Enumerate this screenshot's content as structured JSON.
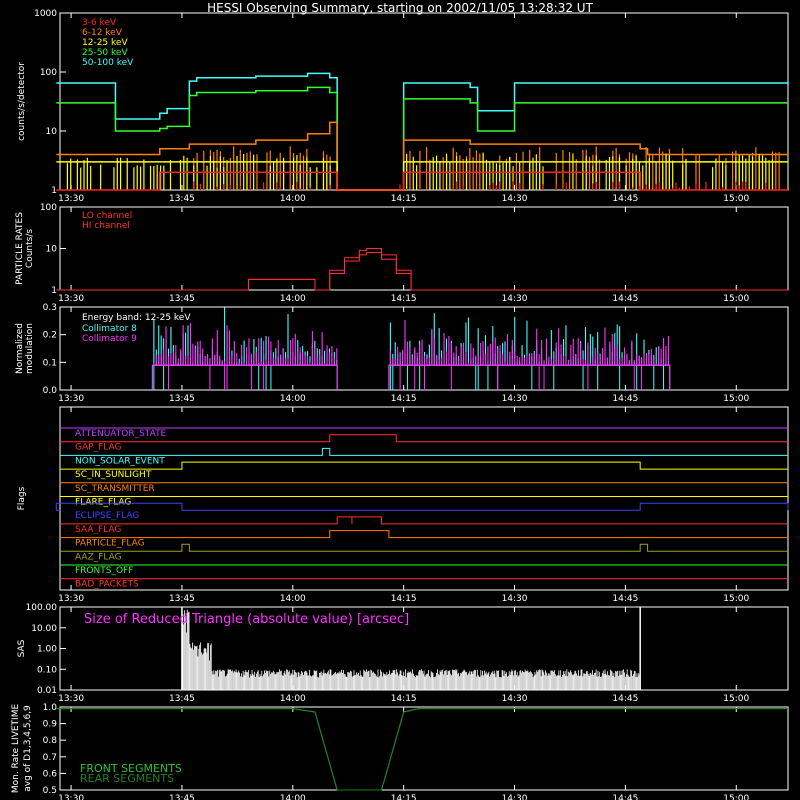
{
  "title": "HESSI Observing Summary, starting on 2002/11/05 13:28:32 UT",
  "time_ticks": [
    "13:30",
    "13:45",
    "14:00",
    "14:15",
    "14:30",
    "14:45",
    "15:00"
  ],
  "colors": {
    "axis": "#ffffff",
    "e3_6": "#ff2020",
    "e6_12": "#ff8000",
    "e12_25": "#ffff00",
    "e25_50": "#30ff30",
    "e50_100": "#40ffff",
    "lo": "#ff3030",
    "hi": "#ff3030",
    "coll8": "#40ffff",
    "coll9": "#ff30ff",
    "sas": "#ff30ff",
    "front": "#30c030",
    "rear": "#208020"
  },
  "chart_data": [
    {
      "type": "line",
      "panel": "count_rates",
      "ylabel": "counts/s/detector",
      "yscale": "log",
      "ylim": [
        1,
        1000
      ],
      "yticks": [
        "1",
        "10",
        "100",
        "1000"
      ],
      "x": [
        "13:28",
        "13:35",
        "13:36",
        "13:42",
        "13:43",
        "13:46",
        "13:47",
        "13:55",
        "14:02",
        "14:05",
        "14:06",
        "14:14",
        "14:15",
        "14:24",
        "14:25",
        "14:30",
        "14:40",
        "14:47",
        "14:48",
        "15:00",
        "15:07"
      ],
      "series": [
        {
          "name": "3-6 keV",
          "values": [
            1,
            1,
            1,
            2,
            2,
            2,
            2,
            2,
            2,
            2,
            1,
            1,
            2,
            2,
            2,
            2,
            2,
            1,
            1,
            1,
            1
          ]
        },
        {
          "name": "6-12 keV",
          "values": [
            4,
            4,
            4,
            5,
            5,
            6,
            6,
            7,
            9,
            14,
            1,
            1,
            7,
            6,
            6,
            6,
            6,
            5,
            4,
            4,
            4
          ]
        },
        {
          "name": "12-25 keV",
          "values": [
            3,
            3,
            3,
            3,
            3,
            3,
            3,
            3,
            3,
            3,
            1,
            1,
            3,
            3,
            3,
            3,
            3,
            3,
            3,
            3,
            3
          ]
        },
        {
          "name": "25-50 keV",
          "values": [
            30,
            30,
            10,
            11,
            12,
            40,
            45,
            48,
            55,
            45,
            1,
            1,
            35,
            30,
            10,
            30,
            30,
            30,
            30,
            30,
            30
          ]
        },
        {
          "name": "50-100 keV",
          "values": [
            65,
            65,
            16,
            20,
            24,
            70,
            80,
            85,
            95,
            80,
            1,
            1,
            65,
            55,
            22,
            65,
            65,
            65,
            65,
            65,
            60
          ]
        }
      ]
    },
    {
      "type": "line",
      "panel": "particle_rates",
      "ylabel": "PARTICLE RATES Counts/s",
      "yscale": "log",
      "ylim": [
        1,
        100
      ],
      "yticks": [
        "1",
        "10",
        "100"
      ],
      "x": [
        "13:28",
        "13:52",
        "13:54",
        "14:03",
        "14:05",
        "14:07",
        "14:09",
        "14:10",
        "14:12",
        "14:14",
        "14:16",
        "15:07"
      ],
      "series": [
        {
          "name": "LO channel",
          "values": [
            1,
            1,
            1.8,
            1,
            3,
            6,
            9,
            10,
            7,
            3,
            1,
            1
          ]
        },
        {
          "name": "HI channel",
          "values": [
            1,
            1,
            1.8,
            1,
            2.5,
            5,
            7,
            8,
            5.5,
            2.5,
            1,
            1
          ]
        }
      ]
    },
    {
      "type": "line",
      "panel": "modulation",
      "ylabel": "Normalized modulation",
      "ylim": [
        0,
        0.3
      ],
      "yticks": [
        "0.0",
        "0.1",
        "0.2",
        "0.3"
      ],
      "annotation": "Energy band: 12-25 keV",
      "x_range": [
        [
          "13:41",
          "14:06"
        ],
        [
          "14:13",
          "14:51"
        ]
      ],
      "series": [
        {
          "name": "Collimator 8",
          "baseline": 0.09,
          "max": 0.3
        },
        {
          "name": "Collimator 9",
          "baseline": 0.09,
          "max": 0.26
        }
      ]
    },
    {
      "type": "line",
      "panel": "flags",
      "ylabel": "Flags",
      "series": [
        {
          "name": "ATTENUATOR_STATE",
          "color": "#c040ff",
          "on": []
        },
        {
          "name": "GAP_FLAG",
          "color": "#ff3030",
          "on": [
            [
              "14:05",
              "14:14"
            ]
          ]
        },
        {
          "name": "NON_SOLAR_EVENT",
          "color": "#40ffff",
          "on": [
            [
              "14:04",
              "14:05"
            ]
          ]
        },
        {
          "name": "SC_IN_SUNLIGHT",
          "color": "#ffff00",
          "on": [
            [
              "13:45",
              "14:47"
            ]
          ]
        },
        {
          "name": "SC_TRANSMITTER",
          "color": "#ff8000",
          "on": []
        },
        {
          "name": "FLARE_FLAG",
          "color": "#ffff00",
          "on": []
        },
        {
          "name": "ECLIPSE_FLAG",
          "color": "#4040ff",
          "on": [
            [
              "13:28",
              "13:45"
            ],
            [
              "14:47",
              "15:07"
            ]
          ]
        },
        {
          "name": "SAA_FLAG",
          "color": "#ff3030",
          "on": [
            [
              "14:06",
              "14:08"
            ],
            [
              "14:08",
              "14:12"
            ]
          ]
        },
        {
          "name": "PARTICLE_FLAG",
          "color": "#ff8000",
          "on": [
            [
              "14:05",
              "14:13"
            ]
          ]
        },
        {
          "name": "AAZ_FLAG",
          "color": "#a0a020",
          "on": [
            [
              "13:45",
              "13:46"
            ],
            [
              "14:47",
              "14:48"
            ]
          ]
        },
        {
          "name": "FRONTS_OFF",
          "color": "#30ff30",
          "on": []
        },
        {
          "name": "BAD_PACKETS",
          "color": "#ff3030",
          "on": []
        }
      ]
    },
    {
      "type": "line",
      "panel": "sas",
      "ylabel": "SAS",
      "yscale": "log",
      "ylim": [
        0.01,
        100
      ],
      "yticks": [
        "0.01",
        "0.10",
        "1.00",
        "10.00",
        "100.00"
      ],
      "annotation": "Size of Reduced Triangle (absolute value) [arcsec]",
      "x_range": [
        [
          "13:45",
          "14:47"
        ]
      ],
      "series": [
        {
          "name": "triangle",
          "baseline": 0.04,
          "peak_start": 100,
          "peak_end": 100
        }
      ]
    },
    {
      "type": "line",
      "panel": "livetime",
      "ylabel": "Mon. Rate LIVETIME avg of D1,3,4,5,6,9",
      "ylim": [
        0.5,
        1.0
      ],
      "yticks": [
        "0.5",
        "0.6",
        "0.7",
        "0.8",
        "0.9",
        "1.0"
      ],
      "x": [
        "13:28",
        "14:00",
        "14:03",
        "14:06",
        "14:12",
        "14:15",
        "14:17",
        "15:07"
      ],
      "series": [
        {
          "name": "FRONT SEGMENTS",
          "values": [
            0.99,
            0.99,
            0.97,
            0.5,
            0.5,
            0.97,
            0.99,
            0.99
          ]
        },
        {
          "name": "REAR SEGMENTS",
          "values": [
            0.99,
            0.99,
            0.97,
            0.5,
            0.5,
            0.97,
            0.99,
            0.99
          ]
        }
      ]
    }
  ]
}
